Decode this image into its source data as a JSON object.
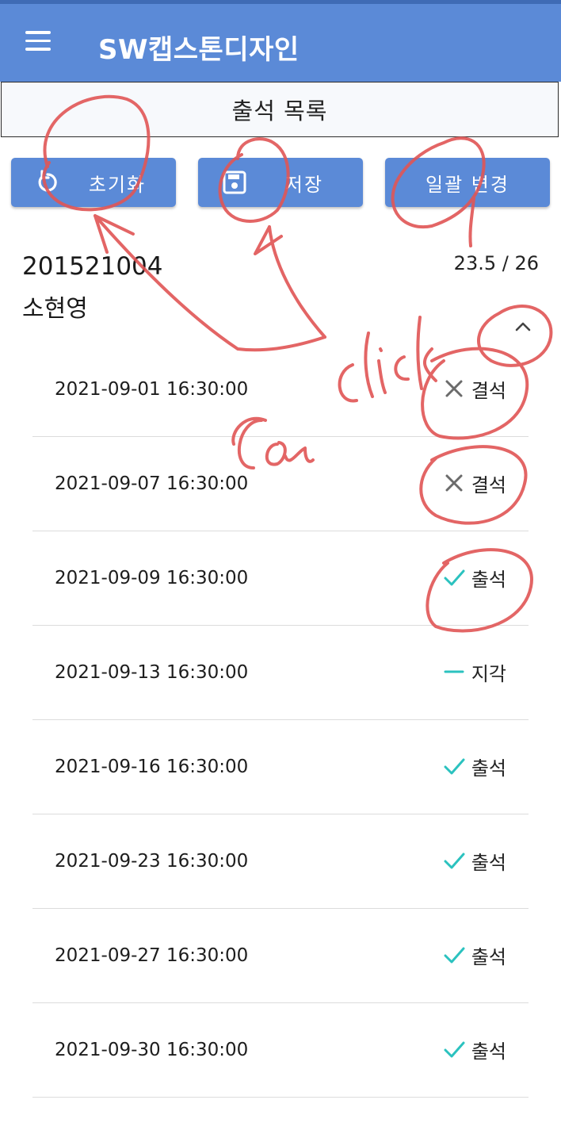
{
  "appbar": {
    "title": "SW캡스톤디자인",
    "menu_icon": "hamburger-menu-icon",
    "background": "#5b8ad7"
  },
  "subheader": {
    "title": "출석 목록"
  },
  "actions": {
    "reset": {
      "label": "초기화",
      "icon": "refresh-icon"
    },
    "save": {
      "label": "저장",
      "icon": "save-icon"
    },
    "bulk": {
      "label": "일괄 변경"
    }
  },
  "student": {
    "id": "201521004",
    "name": "소현영",
    "score": "23.5 / 26"
  },
  "records": [
    {
      "date": "2021-09-01 16:30:00",
      "status": "결석",
      "icon": "close-x-icon"
    },
    {
      "date": "2021-09-07 16:30:00",
      "status": "결석",
      "icon": "close-x-icon"
    },
    {
      "date": "2021-09-09 16:30:00",
      "status": "출석",
      "icon": "check-icon"
    },
    {
      "date": "2021-09-13 16:30:00",
      "status": "지각",
      "icon": "dash-icon"
    },
    {
      "date": "2021-09-16 16:30:00",
      "status": "출석",
      "icon": "check-icon"
    },
    {
      "date": "2021-09-23 16:30:00",
      "status": "출석",
      "icon": "check-icon"
    },
    {
      "date": "2021-09-27 16:30:00",
      "status": "출석",
      "icon": "check-icon"
    },
    {
      "date": "2021-09-30 16:30:00",
      "status": "출석",
      "icon": "check-icon"
    }
  ],
  "colors": {
    "accent": "#5b8ad7",
    "teal": "#2bc2bf",
    "absent": "#6b6b6b",
    "annotation": "#e05555"
  }
}
